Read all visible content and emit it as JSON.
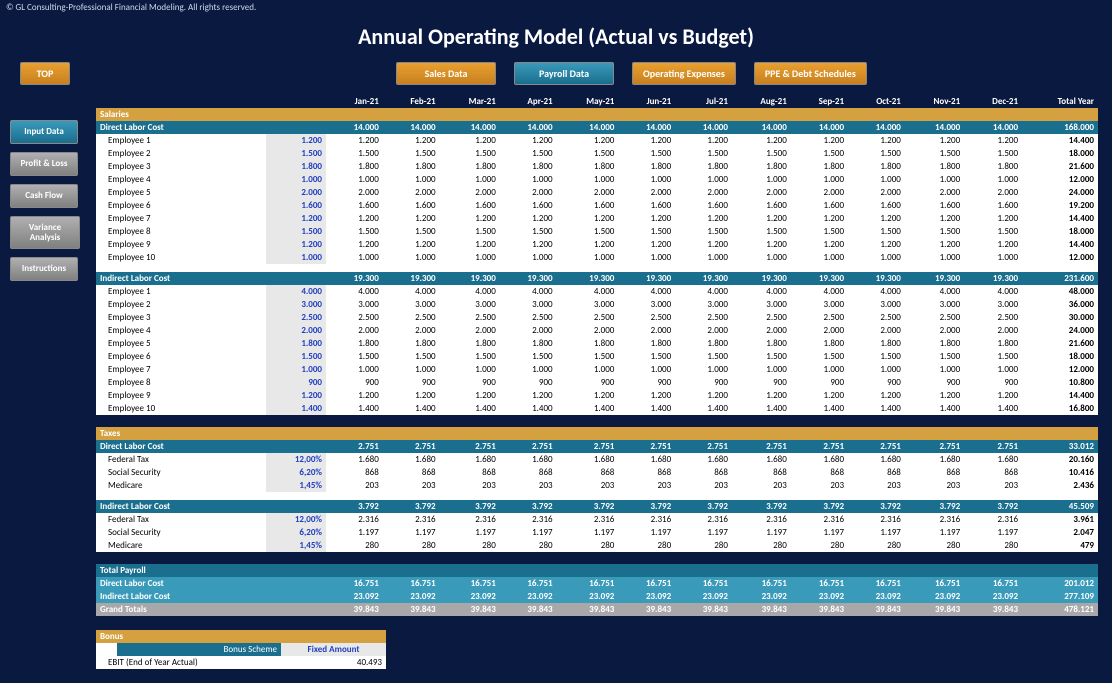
{
  "copyright": "© GL Consulting-Professional Financial Modeling. All rights reserved.",
  "title": "Annual Operating Model (Actual vs Budget)",
  "topButtons": {
    "top": "TOP",
    "sales": "Sales Data",
    "payroll": "Payroll Data",
    "opex": "Operating Expenses",
    "ppe": "PPE & Debt Schedules"
  },
  "sideButtons": {
    "input": "Input Data",
    "pl": "Profit & Loss",
    "cf": "Cash Flow",
    "va": "Variance Analysis",
    "instr": "Instructions"
  },
  "months": [
    "Jan-21",
    "Feb-21",
    "Mar-21",
    "Apr-21",
    "May-21",
    "Jun-21",
    "Jul-21",
    "Aug-21",
    "Sep-21",
    "Oct-21",
    "Nov-21",
    "Dec-21",
    "Total Year"
  ],
  "sections": {
    "salaries": "Salaries",
    "taxes": "Taxes",
    "totalPayroll": "Total Payroll",
    "directLaborCost": "Direct Labor Cost",
    "indirectLaborCost": "Indirect Labor Cost",
    "grandTotals": "Grand Totals"
  },
  "directSalTotal": {
    "month": "14.000",
    "year": "168.000"
  },
  "directEmployees": [
    {
      "name": "Employee 1",
      "input": "1.200",
      "m": "1.200",
      "y": "14.400"
    },
    {
      "name": "Employee 2",
      "input": "1.500",
      "m": "1.500",
      "y": "18.000"
    },
    {
      "name": "Employee 3",
      "input": "1.800",
      "m": "1.800",
      "y": "21.600"
    },
    {
      "name": "Employee 4",
      "input": "1.000",
      "m": "1.000",
      "y": "12.000"
    },
    {
      "name": "Employee 5",
      "input": "2.000",
      "m": "2.000",
      "y": "24.000"
    },
    {
      "name": "Employee 6",
      "input": "1.600",
      "m": "1.600",
      "y": "19.200"
    },
    {
      "name": "Employee 7",
      "input": "1.200",
      "m": "1.200",
      "y": "14.400"
    },
    {
      "name": "Employee 8",
      "input": "1.500",
      "m": "1.500",
      "y": "18.000"
    },
    {
      "name": "Employee 9",
      "input": "1.200",
      "m": "1.200",
      "y": "14.400"
    },
    {
      "name": "Employee 10",
      "input": "1.000",
      "m": "1.000",
      "y": "12.000"
    }
  ],
  "indirectSalTotal": {
    "month": "19.300",
    "year": "231.600"
  },
  "indirectEmployees": [
    {
      "name": "Employee 1",
      "input": "4.000",
      "m": "4.000",
      "y": "48.000"
    },
    {
      "name": "Employee 2",
      "input": "3.000",
      "m": "3.000",
      "y": "36.000"
    },
    {
      "name": "Employee 3",
      "input": "2.500",
      "m": "2.500",
      "y": "30.000"
    },
    {
      "name": "Employee 4",
      "input": "2.000",
      "m": "2.000",
      "y": "24.000"
    },
    {
      "name": "Employee 5",
      "input": "1.800",
      "m": "1.800",
      "y": "21.600"
    },
    {
      "name": "Employee 6",
      "input": "1.500",
      "m": "1.500",
      "y": "18.000"
    },
    {
      "name": "Employee 7",
      "input": "1.000",
      "m": "1.000",
      "y": "12.000"
    },
    {
      "name": "Employee 8",
      "input": "900",
      "m": "900",
      "y": "10.800"
    },
    {
      "name": "Employee 9",
      "input": "1.200",
      "m": "1.200",
      "y": "14.400"
    },
    {
      "name": "Employee 10",
      "input": "1.400",
      "m": "1.400",
      "y": "16.800"
    }
  ],
  "taxDirectTotal": {
    "month": "2.751",
    "year": "33.012"
  },
  "taxDirectRows": [
    {
      "name": "Federal Tax",
      "rate": "12,00%",
      "m": "1.680",
      "y": "20.160"
    },
    {
      "name": "Social Security",
      "rate": "6,20%",
      "m": "868",
      "y": "10.416"
    },
    {
      "name": "Medicare",
      "rate": "1,45%",
      "m": "203",
      "y": "2.436"
    }
  ],
  "taxIndirectTotal": {
    "month": "3.792",
    "year": "45.509"
  },
  "taxIndirectRows": [
    {
      "name": "Federal Tax",
      "rate": "12,00%",
      "m": "2.316",
      "y": "3.961"
    },
    {
      "name": "Social Security",
      "rate": "6,20%",
      "m": "1.197",
      "y": "2.047"
    },
    {
      "name": "Medicare",
      "rate": "1,45%",
      "m": "280",
      "y": "479"
    }
  ],
  "totalPayroll": {
    "direct": {
      "m": "16.751",
      "y": "201.012"
    },
    "indirect": {
      "m": "23.092",
      "y": "277.109"
    },
    "grand": {
      "m": "39.843",
      "y": "478.121"
    }
  },
  "bonus": {
    "title": "Bonus",
    "schemeLabel": "Bonus Scheme",
    "schemeValue": "Fixed Amount",
    "ebitLabel": "EBIT (End of Year Actual)",
    "ebitValue": "40.493"
  }
}
